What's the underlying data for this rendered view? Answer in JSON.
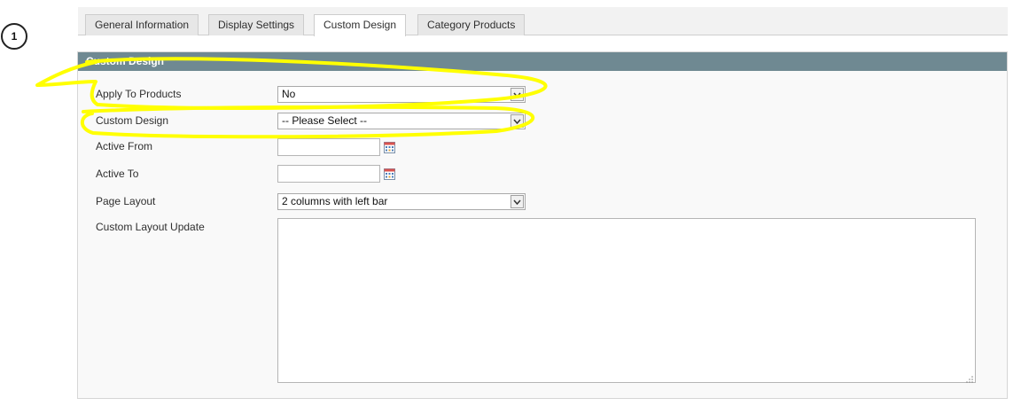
{
  "step_marker": "1",
  "tabs": [
    {
      "label": "General Information"
    },
    {
      "label": "Display Settings"
    },
    {
      "label": "Custom Design",
      "active": true
    },
    {
      "label": "Category Products"
    }
  ],
  "section": {
    "title": "Custom Design"
  },
  "fields": {
    "apply_to_products": {
      "label": "Apply To Products",
      "value": "No"
    },
    "custom_design": {
      "label": "Custom Design",
      "value": "-- Please Select --"
    },
    "active_from": {
      "label": "Active From",
      "value": ""
    },
    "active_to": {
      "label": "Active To",
      "value": ""
    },
    "page_layout": {
      "label": "Page Layout",
      "value": "2 columns with left bar"
    },
    "custom_layout_update": {
      "label": "Custom Layout Update",
      "value": ""
    }
  },
  "icons": {
    "select_arrow": "chevron-down-icon",
    "calendar": "calendar-icon",
    "resize": "resize-grip-icon"
  },
  "colors": {
    "section_header": "#6f8992",
    "highlight": "#ffff00",
    "tab_active": "#ffffff",
    "tab_inactive": "#e7e7e7"
  }
}
